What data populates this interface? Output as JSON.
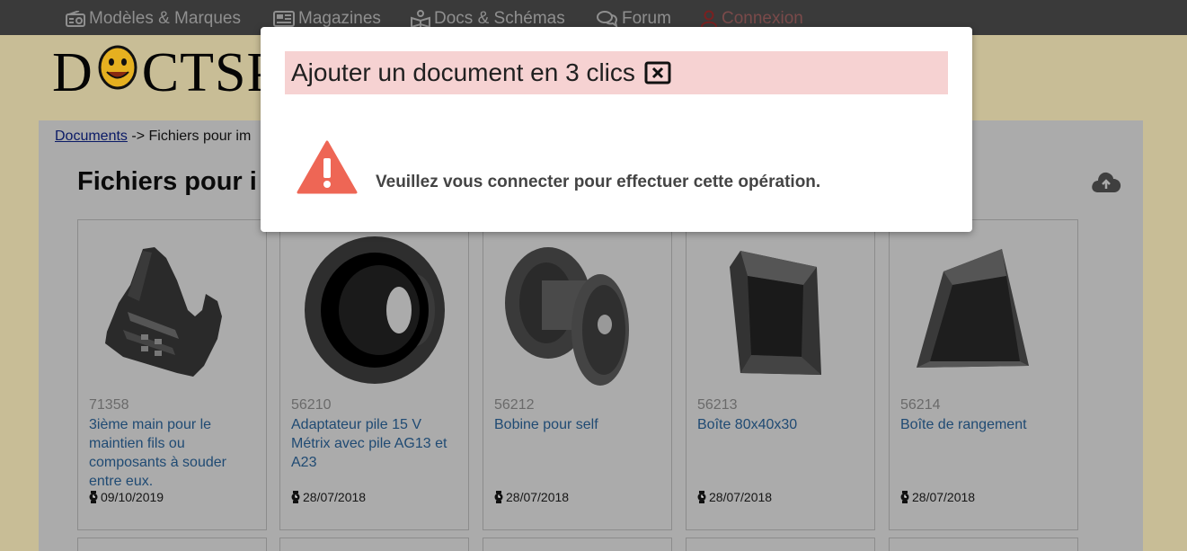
{
  "nav": {
    "items": [
      {
        "label": "Modèles & Marques",
        "icon": "radio-icon"
      },
      {
        "label": "Magazines",
        "icon": "newspaper-icon"
      },
      {
        "label": "Docs & Schémas",
        "icon": "book-reader-icon"
      },
      {
        "label": "Forum",
        "icon": "comments-icon"
      },
      {
        "label": "Connexion",
        "icon": "user-icon"
      }
    ]
  },
  "logo": {
    "text_left": "D",
    "text_right": "CTSP"
  },
  "breadcrumb": {
    "root": "Documents",
    "separator": " -> ",
    "current": "Fichiers pour im"
  },
  "page": {
    "title": "Fichiers pour i"
  },
  "cards": [
    {
      "id": "71358",
      "title": "3ième main pour le maintien fils ou composants à souder entre eux.",
      "date": "09/10/2019"
    },
    {
      "id": "56210",
      "title": "Adaptateur pile 15 V Métrix avec pile AG13 et A23",
      "date": "28/07/2018"
    },
    {
      "id": "56212",
      "title": "Bobine pour self",
      "date": "28/07/2018"
    },
    {
      "id": "56213",
      "title": "Boîte 80x40x30",
      "date": "28/07/2018"
    },
    {
      "id": "56214",
      "title": "Boîte de rangement",
      "date": "28/07/2018"
    }
  ],
  "modal": {
    "title": "Ajouter un document en 3 clics",
    "message": "Veuillez vous connecter pour effectuer cette opération."
  },
  "colors": {
    "modal_header": "#f6d2d2",
    "warning": "#ee6655",
    "link": "#1f4a73",
    "nav_bg": "#3a3a3a"
  }
}
